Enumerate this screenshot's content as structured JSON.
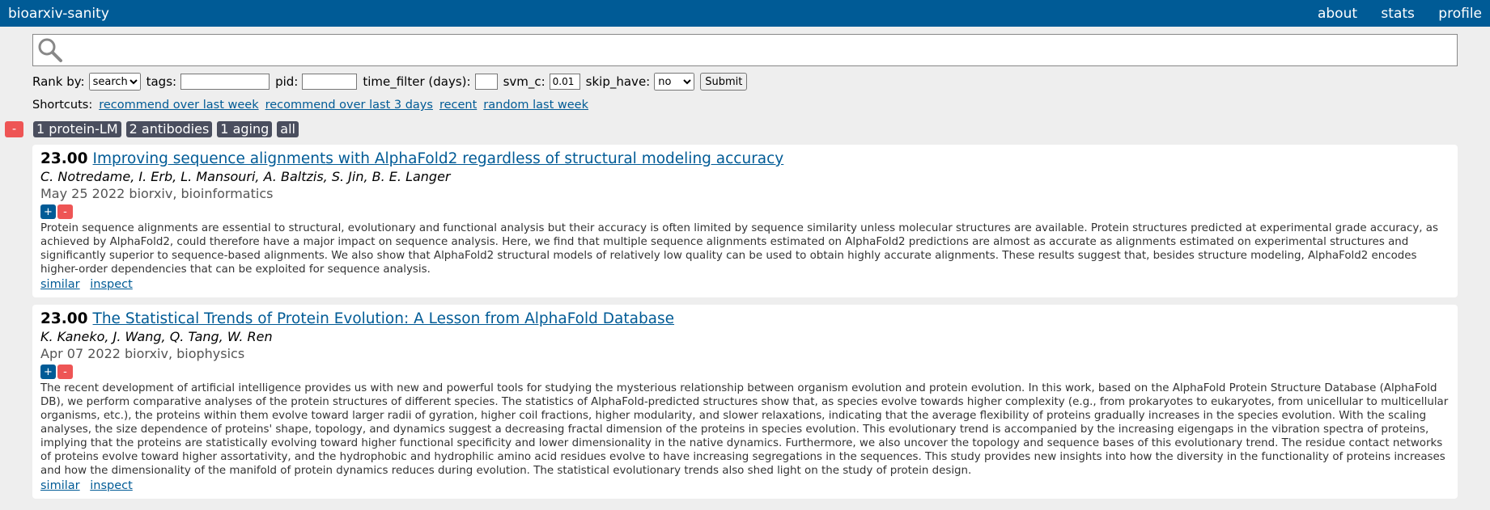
{
  "app": {
    "title": "bioarxiv-sanity",
    "nav": [
      "about",
      "stats",
      "profile"
    ]
  },
  "search": {
    "value": "",
    "placeholder": ""
  },
  "controls": {
    "rank_label": "Rank by:",
    "rank_value": "search",
    "tags_label": "tags:",
    "tags_value": "",
    "pid_label": "pid:",
    "pid_value": "",
    "time_label": "time_filter (days):",
    "time_value": "",
    "svm_label": "svm_c:",
    "svm_value": "0.01",
    "skip_label": "skip_have:",
    "skip_value": "no",
    "submit_label": "Submit"
  },
  "shortcuts": {
    "label": "Shortcuts:",
    "links": [
      "recommend over last week",
      "recommend over last 3 days",
      "recent",
      "random last week"
    ]
  },
  "tags": {
    "remove_symbol": "-",
    "items": [
      "1 protein-LM",
      "2 antibodies",
      "1 aging",
      "all"
    ]
  },
  "papers": [
    {
      "score": "23.00",
      "title": "Improving sequence alignments with AlphaFold2 regardless of structural modeling accuracy",
      "authors": "C. Notredame, I. Erb, L. Mansouri, A. Baltzis, S. Jin, B. E. Langer",
      "meta": "May 25 2022 biorxiv, bioinformatics",
      "plus": "+",
      "minus": "-",
      "abstract": "Protein sequence alignments are essential to structural, evolutionary and functional analysis but their accuracy is often limited by sequence similarity unless molecular structures are available. Protein structures predicted at experimental grade accuracy, as achieved by AlphaFold2, could therefore have a major impact on sequence analysis. Here, we find that multiple sequence alignments estimated on AlphaFold2 predictions are almost as accurate as alignments estimated on experimental structures and significantly superior to sequence-based alignments. We also show that AlphaFold2 structural models of relatively low quality can be used to obtain highly accurate alignments. These results suggest that, besides structure modeling, AlphaFold2 encodes higher-order dependencies that can be exploited for sequence analysis.",
      "similar": "similar",
      "inspect": "inspect"
    },
    {
      "score": "23.00",
      "title": "The Statistical Trends of Protein Evolution: A Lesson from AlphaFold Database",
      "authors": "K. Kaneko, J. Wang, Q. Tang, W. Ren",
      "meta": "Apr 07 2022 biorxiv, biophysics",
      "plus": "+",
      "minus": "-",
      "abstract": "The recent development of artificial intelligence provides us with new and powerful tools for studying the mysterious relationship between organism evolution and protein evolution. In this work, based on the AlphaFold Protein Structure Database (AlphaFold DB), we perform comparative analyses of the protein structures of different species. The statistics of AlphaFold-predicted structures show that, as species evolve towards higher complexity (e.g., from prokaryotes to eukaryotes, from unicellular to multicellular organisms, etc.), the proteins within them evolve toward larger radii of gyration, higher coil fractions, higher modularity, and slower relaxations, indicating that the average flexibility of proteins gradually increases in the species evolution. With the scaling analyses, the size dependence of proteins' shape, topology, and dynamics suggest a decreasing fractal dimension of the proteins in species evolution. This evolutionary trend is accompanied by the increasing eigengaps in the vibration spectra of proteins, implying that the proteins are statistically evolving toward higher functional specificity and lower dimensionality in the native dynamics. Furthermore, we also uncover the topology and sequence bases of this evolutionary trend. The residue contact networks of proteins evolve toward higher assortativity, and the hydrophobic and hydrophilic amino acid residues evolve to have increasing segregations in the sequences. This study provides new insights into how the diversity in the functionality of proteins increases and how the dimensionality of the manifold of protein dynamics reduces during evolution. The statistical evolutionary trends also shed light on the study of protein design.",
      "similar": "similar",
      "inspect": "inspect"
    }
  ]
}
